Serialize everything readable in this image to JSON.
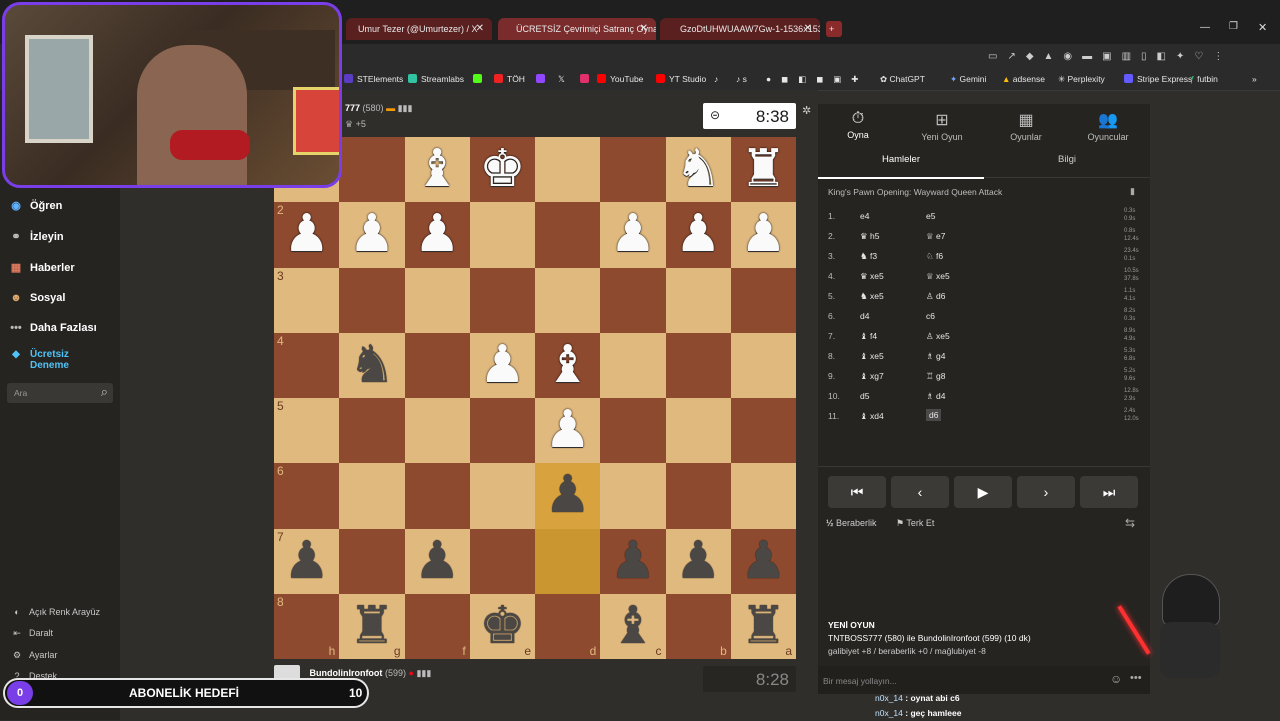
{
  "browser": {
    "tabs": [
      {
        "label": "Umur Tezer (@Umurtezer) / X"
      },
      {
        "label": "ÜCRETSİZ Çevrimiçi Satranç Oyna"
      },
      {
        "label": "GzoDtUHWUAAW7Gw-1-1536x1536"
      }
    ],
    "new_tab": "+",
    "bookmarks": [
      "STElements",
      "Streamlabs",
      "TÖH",
      "YouTube",
      "YT Studio",
      "s",
      "ChatGPT",
      "Gemini",
      "adsense",
      "Perplexity",
      "Stripe Express",
      "futbin"
    ],
    "more": "»"
  },
  "sidebar": {
    "items": [
      {
        "label": "Öğren",
        "icon": "learn-icon"
      },
      {
        "label": "İzleyin",
        "icon": "binoculars-icon"
      },
      {
        "label": "Haberler",
        "icon": "news-icon"
      },
      {
        "label": "Sosyal",
        "icon": "social-icon"
      },
      {
        "label": "Daha Fazlası",
        "icon": "more-icon"
      },
      {
        "label": "Ücretsiz Deneme",
        "icon": "diamond-icon"
      }
    ],
    "search_placeholder": "Ara",
    "footer": [
      "Açık Renk Arayüz",
      "Daralt",
      "Ayarlar",
      "Destek"
    ]
  },
  "top_player": {
    "name": "777",
    "rating": "(580)",
    "material": "+5",
    "clock": "8:38"
  },
  "bottom_player": {
    "name": "BundolinIronfoot",
    "rating": "(599)",
    "clock": "8:28"
  },
  "board": {
    "ranks": [
      "1",
      "2",
      "3",
      "4",
      "5",
      "6",
      "7",
      "8"
    ],
    "files": [
      "h",
      "g",
      "f",
      "e",
      "d",
      "c",
      "b",
      "a"
    ],
    "rows": [
      [
        "",
        "",
        "♝w",
        "♚w",
        "",
        "",
        "♞w",
        "♜w"
      ],
      [
        "♟w",
        "♟w",
        "♟w",
        "",
        "",
        "♟w",
        "♟w",
        "♟w"
      ],
      [
        "",
        "",
        "",
        "",
        "",
        "",
        "",
        ""
      ],
      [
        "",
        "♞b",
        "",
        "♟w",
        "♝w",
        "",
        "",
        ""
      ],
      [
        "",
        "",
        "",
        "",
        "♟w",
        "",
        "",
        ""
      ],
      [
        "",
        "",
        "",
        "",
        "♟b",
        "",
        "",
        ""
      ],
      [
        "♟b",
        "",
        "♟b",
        "",
        "",
        "♟b",
        "♟b",
        "♟b"
      ],
      [
        "",
        "♜b",
        "",
        "♚b",
        "",
        "♝b",
        "",
        "♜b"
      ]
    ]
  },
  "panel": {
    "tabs": [
      "Oyna",
      "Yeni Oyun",
      "Oyunlar",
      "Oyuncular"
    ],
    "subtabs": [
      "Hamleler",
      "Bilgi"
    ],
    "opening": "King's Pawn Opening: Wayward Queen Attack",
    "moves": [
      {
        "n": "1.",
        "w": "e4",
        "b": "e5",
        "t": "0.3s\n0.9s"
      },
      {
        "n": "2.",
        "w": "♛ h5",
        "b": "♕ e7",
        "t": "0.8s\n12.4s"
      },
      {
        "n": "3.",
        "w": "♞ f3",
        "b": "♘ f6",
        "t": "23.4s\n0.1s"
      },
      {
        "n": "4.",
        "w": "♛ xe5",
        "b": "♕ xe5",
        "t": "10.5s\n37.8s"
      },
      {
        "n": "5.",
        "w": "♞ xe5",
        "b": "♙ d6",
        "t": "1.1s\n4.1s"
      },
      {
        "n": "6.",
        "w": "d4",
        "b": "c6",
        "t": "8.2s\n0.3s"
      },
      {
        "n": "7.",
        "w": "♝ f4",
        "b": "♙ xe5",
        "t": "8.9s\n4.9s"
      },
      {
        "n": "8.",
        "w": "♝ xe5",
        "b": "♗ g4",
        "t": "5.3s\n6.8s"
      },
      {
        "n": "9.",
        "w": "♝ xg7",
        "b": "♖ g8",
        "t": "5.2s\n9.6s"
      },
      {
        "n": "10.",
        "w": "d5",
        "b": "♗ d4",
        "t": "12.8s\n2.9s"
      },
      {
        "n": "11.",
        "w": "♝ xd4",
        "b": "d6",
        "t": "2.4s\n12.0s"
      }
    ],
    "controls": [
      "⏮",
      "‹",
      "▶",
      "›",
      "⏭"
    ],
    "draw": "Beraberlik",
    "resign": "Terk Et",
    "new_game_title": "YENİ OYUN",
    "new_game_line": "TNTBOSS777 (580) ile BundolinIronfoot (599) (10 dk)",
    "new_game_stats": "galibiyet +8 / beraberlik +0 / mağlubiyet -8",
    "chat_placeholder": "Bir mesaj yollayın..."
  },
  "stream_chat": [
    {
      "user": "n0x_14",
      "text": " : oynat abi c6"
    },
    {
      "user": "n0x_14",
      "text": " : geç hamleee"
    }
  ],
  "sub_goal": {
    "current": "0",
    "label": "ABONELİK HEDEFİ",
    "target": "10"
  }
}
